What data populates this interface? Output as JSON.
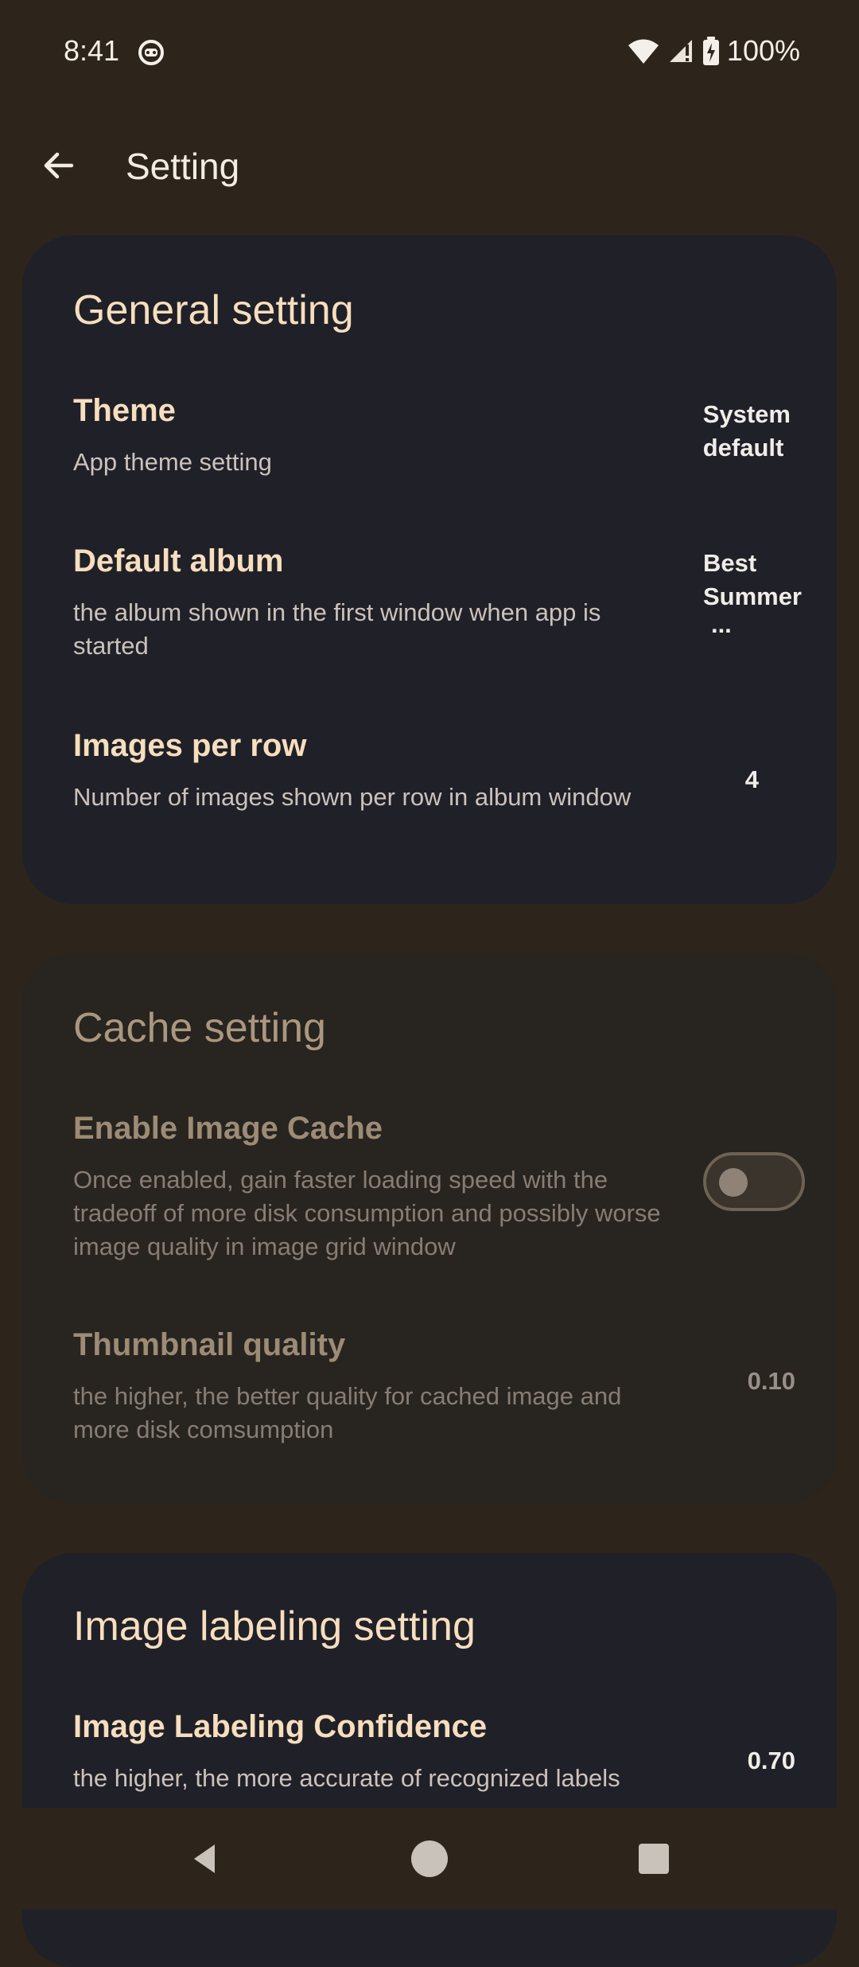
{
  "status_bar": {
    "time": "8:41",
    "battery": "100%",
    "icons": [
      "robot-face-icon",
      "wifi-icon",
      "signal-icon",
      "battery-charging-icon"
    ]
  },
  "app_bar": {
    "title": "Setting",
    "back_icon": "arrow-left-icon"
  },
  "general": {
    "title": "General setting",
    "rows": [
      {
        "title": "Theme",
        "description": "App theme setting",
        "value_line1": "System",
        "value_line2": "default"
      },
      {
        "title": "Default album",
        "description": "the album shown in the first window when app is started",
        "value_line1": "Best",
        "value_line2": "Summer",
        "value_line3": "..."
      },
      {
        "title": "Images per row",
        "description": "Number of images shown per row in album window",
        "value": "4"
      }
    ]
  },
  "cache": {
    "title": "Cache setting",
    "rows": [
      {
        "title": "Enable Image Cache",
        "description": "Once enabled, gain faster loading speed with the tradeoff of more disk consumption and possibly worse image quality in image grid window",
        "toggle_state": "off"
      },
      {
        "title": "Thumbnail quality",
        "description": "the higher, the better quality for cached image and more disk comsumption",
        "value": "0.10"
      }
    ]
  },
  "labeling": {
    "title": "Image labeling setting",
    "rows": [
      {
        "title": "Image Labeling Confidence",
        "description": "the higher, the more accurate of recognized labels",
        "value": "0.70"
      }
    ]
  },
  "nav": {
    "icons": [
      "back-triangle-icon",
      "home-circle-icon",
      "recents-square-icon"
    ]
  },
  "colors": {
    "background": "#2d241c",
    "card": "#202028",
    "card_disabled": "#28241f",
    "accent_text": "#f6debe"
  }
}
